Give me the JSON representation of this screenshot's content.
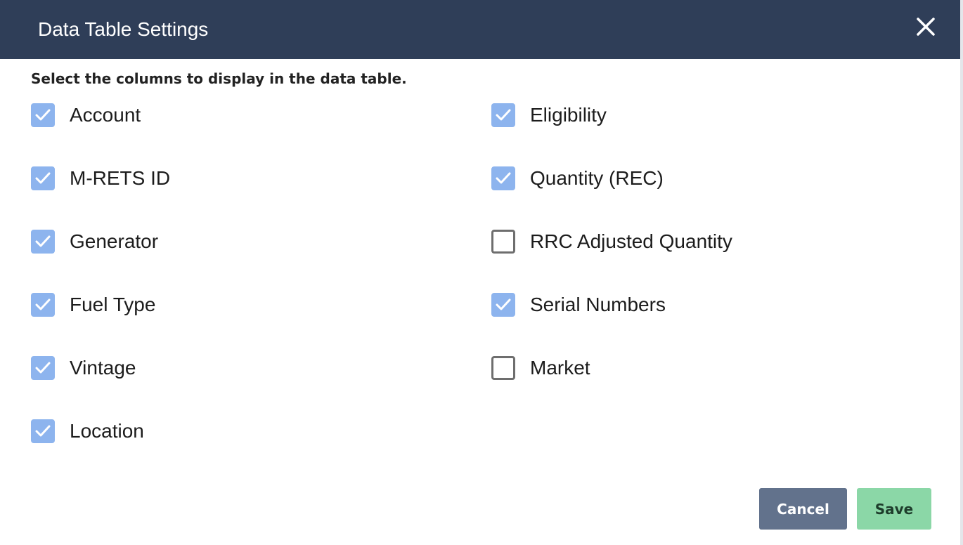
{
  "dialog": {
    "title": "Data Table Settings",
    "close_icon": "close-icon",
    "instructions": "Select the columns to display in the data table."
  },
  "columns": {
    "left": [
      {
        "label": "Account",
        "checked": true
      },
      {
        "label": "M-RETS ID",
        "checked": true
      },
      {
        "label": "Generator",
        "checked": true
      },
      {
        "label": "Fuel Type",
        "checked": true
      },
      {
        "label": "Vintage",
        "checked": true
      },
      {
        "label": "Location",
        "checked": true
      }
    ],
    "right": [
      {
        "label": "Eligibility",
        "checked": true
      },
      {
        "label": "Quantity (REC)",
        "checked": true
      },
      {
        "label": "RRC Adjusted Quantity",
        "checked": false
      },
      {
        "label": "Serial Numbers",
        "checked": true
      },
      {
        "label": "Market",
        "checked": false
      }
    ]
  },
  "buttons": {
    "cancel_label": "Cancel",
    "save_label": "Save"
  },
  "colors": {
    "header_bg": "#2f3e58",
    "checkbox_checked": "#8db4ee",
    "cancel_bg": "#62728c",
    "save_bg": "#8bd7a7"
  }
}
